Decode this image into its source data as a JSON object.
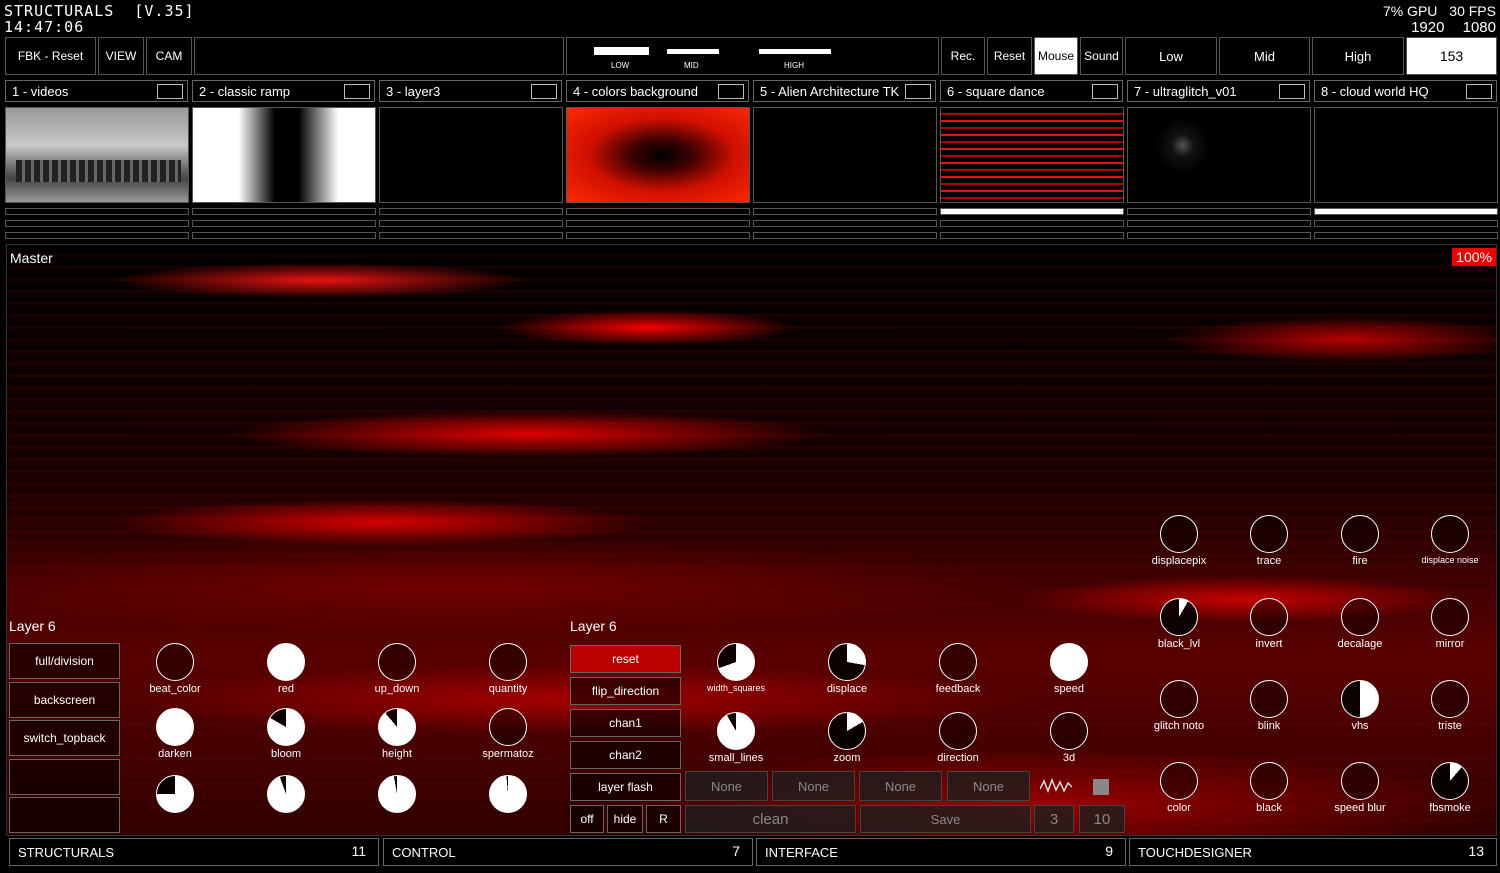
{
  "app": {
    "title": "STRUCTURALS",
    "version": "[V.35]",
    "time": "14:47:06"
  },
  "stats": {
    "gpu": "7% GPU",
    "fps": "30 FPS",
    "width": "1920",
    "height": "1080"
  },
  "toolbar": {
    "fbk_reset": "FBK - Reset",
    "view": "VIEW",
    "cam": "CAM",
    "low_label": "LOW",
    "mid_label": "MID",
    "high_label": "HIGH",
    "rec": "Rec.",
    "reset": "Reset",
    "mouse": "Mouse",
    "sound": "Sound",
    "low": "Low",
    "mid": "Mid",
    "high": "High",
    "value": "153"
  },
  "layers": [
    {
      "label": "1 - videos"
    },
    {
      "label": "2 - classic ramp"
    },
    {
      "label": "3 - layer3"
    },
    {
      "label": "4 - colors background"
    },
    {
      "label": "5 - Alien Architecture TK"
    },
    {
      "label": "6 - square dance"
    },
    {
      "label": "7 - ultraglitch_v01"
    },
    {
      "label": "8 - cloud world HQ"
    }
  ],
  "master": {
    "label": "Master",
    "percent": "100%"
  },
  "left_panel": {
    "title": "Layer 6",
    "buttons": [
      "full/division",
      "backscreen",
      "switch_topback",
      "",
      ""
    ],
    "knobs": [
      "beat_color",
      "red",
      "up_down",
      "quantity",
      "darken",
      "bloom",
      "height",
      "spermatoz",
      "",
      "",
      "",
      ""
    ]
  },
  "mid_panel": {
    "title": "Layer 6",
    "buttons": [
      "reset",
      "flip_direction",
      "chan1",
      "chan2",
      "layer flash"
    ],
    "small_buttons": [
      "off",
      "hide",
      "R"
    ],
    "knobs": [
      "width_squares",
      "displace",
      "feedback",
      "speed",
      "small_lines",
      "zoom",
      "direction",
      "3d"
    ],
    "dropdowns": [
      "None",
      "None",
      "None",
      "None"
    ],
    "clean": "clean",
    "save": "Save",
    "num_a": "3",
    "num_b": "10"
  },
  "right_panel": {
    "knobs": [
      "displacepix",
      "trace",
      "fire",
      "displace noise",
      "black_lvl",
      "invert",
      "decalage",
      "mirror",
      "glitch noto",
      "blink",
      "vhs",
      "triste",
      "color",
      "black",
      "speed blur",
      "fbsmoke"
    ]
  },
  "footer": [
    {
      "label": "STRUCTURALS",
      "num": "11"
    },
    {
      "label": "CONTROL",
      "num": "7"
    },
    {
      "label": "INTERFACE",
      "num": "9"
    },
    {
      "label": "TOUCHDESIGNER",
      "num": "13"
    }
  ],
  "colors": {
    "accent": "#e00000",
    "bg": "#000000",
    "text": "#ffffff"
  }
}
